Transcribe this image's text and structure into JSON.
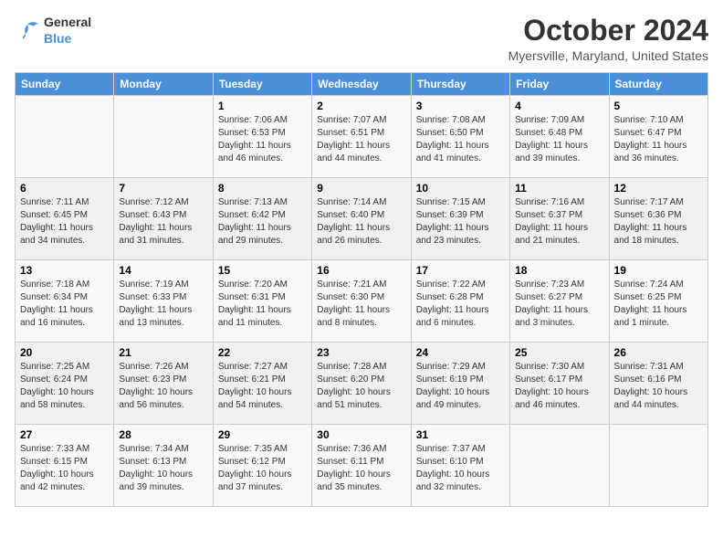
{
  "header": {
    "logo": {
      "general": "General",
      "blue": "Blue"
    },
    "month": "October 2024",
    "location": "Myersville, Maryland, United States"
  },
  "weekdays": [
    "Sunday",
    "Monday",
    "Tuesday",
    "Wednesday",
    "Thursday",
    "Friday",
    "Saturday"
  ],
  "weeks": [
    [
      {
        "day": null
      },
      {
        "day": null
      },
      {
        "day": "1",
        "sunrise": "Sunrise: 7:06 AM",
        "sunset": "Sunset: 6:53 PM",
        "daylight": "Daylight: 11 hours and 46 minutes."
      },
      {
        "day": "2",
        "sunrise": "Sunrise: 7:07 AM",
        "sunset": "Sunset: 6:51 PM",
        "daylight": "Daylight: 11 hours and 44 minutes."
      },
      {
        "day": "3",
        "sunrise": "Sunrise: 7:08 AM",
        "sunset": "Sunset: 6:50 PM",
        "daylight": "Daylight: 11 hours and 41 minutes."
      },
      {
        "day": "4",
        "sunrise": "Sunrise: 7:09 AM",
        "sunset": "Sunset: 6:48 PM",
        "daylight": "Daylight: 11 hours and 39 minutes."
      },
      {
        "day": "5",
        "sunrise": "Sunrise: 7:10 AM",
        "sunset": "Sunset: 6:47 PM",
        "daylight": "Daylight: 11 hours and 36 minutes."
      }
    ],
    [
      {
        "day": "6",
        "sunrise": "Sunrise: 7:11 AM",
        "sunset": "Sunset: 6:45 PM",
        "daylight": "Daylight: 11 hours and 34 minutes."
      },
      {
        "day": "7",
        "sunrise": "Sunrise: 7:12 AM",
        "sunset": "Sunset: 6:43 PM",
        "daylight": "Daylight: 11 hours and 31 minutes."
      },
      {
        "day": "8",
        "sunrise": "Sunrise: 7:13 AM",
        "sunset": "Sunset: 6:42 PM",
        "daylight": "Daylight: 11 hours and 29 minutes."
      },
      {
        "day": "9",
        "sunrise": "Sunrise: 7:14 AM",
        "sunset": "Sunset: 6:40 PM",
        "daylight": "Daylight: 11 hours and 26 minutes."
      },
      {
        "day": "10",
        "sunrise": "Sunrise: 7:15 AM",
        "sunset": "Sunset: 6:39 PM",
        "daylight": "Daylight: 11 hours and 23 minutes."
      },
      {
        "day": "11",
        "sunrise": "Sunrise: 7:16 AM",
        "sunset": "Sunset: 6:37 PM",
        "daylight": "Daylight: 11 hours and 21 minutes."
      },
      {
        "day": "12",
        "sunrise": "Sunrise: 7:17 AM",
        "sunset": "Sunset: 6:36 PM",
        "daylight": "Daylight: 11 hours and 18 minutes."
      }
    ],
    [
      {
        "day": "13",
        "sunrise": "Sunrise: 7:18 AM",
        "sunset": "Sunset: 6:34 PM",
        "daylight": "Daylight: 11 hours and 16 minutes."
      },
      {
        "day": "14",
        "sunrise": "Sunrise: 7:19 AM",
        "sunset": "Sunset: 6:33 PM",
        "daylight": "Daylight: 11 hours and 13 minutes."
      },
      {
        "day": "15",
        "sunrise": "Sunrise: 7:20 AM",
        "sunset": "Sunset: 6:31 PM",
        "daylight": "Daylight: 11 hours and 11 minutes."
      },
      {
        "day": "16",
        "sunrise": "Sunrise: 7:21 AM",
        "sunset": "Sunset: 6:30 PM",
        "daylight": "Daylight: 11 hours and 8 minutes."
      },
      {
        "day": "17",
        "sunrise": "Sunrise: 7:22 AM",
        "sunset": "Sunset: 6:28 PM",
        "daylight": "Daylight: 11 hours and 6 minutes."
      },
      {
        "day": "18",
        "sunrise": "Sunrise: 7:23 AM",
        "sunset": "Sunset: 6:27 PM",
        "daylight": "Daylight: 11 hours and 3 minutes."
      },
      {
        "day": "19",
        "sunrise": "Sunrise: 7:24 AM",
        "sunset": "Sunset: 6:25 PM",
        "daylight": "Daylight: 11 hours and 1 minute."
      }
    ],
    [
      {
        "day": "20",
        "sunrise": "Sunrise: 7:25 AM",
        "sunset": "Sunset: 6:24 PM",
        "daylight": "Daylight: 10 hours and 58 minutes."
      },
      {
        "day": "21",
        "sunrise": "Sunrise: 7:26 AM",
        "sunset": "Sunset: 6:23 PM",
        "daylight": "Daylight: 10 hours and 56 minutes."
      },
      {
        "day": "22",
        "sunrise": "Sunrise: 7:27 AM",
        "sunset": "Sunset: 6:21 PM",
        "daylight": "Daylight: 10 hours and 54 minutes."
      },
      {
        "day": "23",
        "sunrise": "Sunrise: 7:28 AM",
        "sunset": "Sunset: 6:20 PM",
        "daylight": "Daylight: 10 hours and 51 minutes."
      },
      {
        "day": "24",
        "sunrise": "Sunrise: 7:29 AM",
        "sunset": "Sunset: 6:19 PM",
        "daylight": "Daylight: 10 hours and 49 minutes."
      },
      {
        "day": "25",
        "sunrise": "Sunrise: 7:30 AM",
        "sunset": "Sunset: 6:17 PM",
        "daylight": "Daylight: 10 hours and 46 minutes."
      },
      {
        "day": "26",
        "sunrise": "Sunrise: 7:31 AM",
        "sunset": "Sunset: 6:16 PM",
        "daylight": "Daylight: 10 hours and 44 minutes."
      }
    ],
    [
      {
        "day": "27",
        "sunrise": "Sunrise: 7:33 AM",
        "sunset": "Sunset: 6:15 PM",
        "daylight": "Daylight: 10 hours and 42 minutes."
      },
      {
        "day": "28",
        "sunrise": "Sunrise: 7:34 AM",
        "sunset": "Sunset: 6:13 PM",
        "daylight": "Daylight: 10 hours and 39 minutes."
      },
      {
        "day": "29",
        "sunrise": "Sunrise: 7:35 AM",
        "sunset": "Sunset: 6:12 PM",
        "daylight": "Daylight: 10 hours and 37 minutes."
      },
      {
        "day": "30",
        "sunrise": "Sunrise: 7:36 AM",
        "sunset": "Sunset: 6:11 PM",
        "daylight": "Daylight: 10 hours and 35 minutes."
      },
      {
        "day": "31",
        "sunrise": "Sunrise: 7:37 AM",
        "sunset": "Sunset: 6:10 PM",
        "daylight": "Daylight: 10 hours and 32 minutes."
      },
      {
        "day": null
      },
      {
        "day": null
      }
    ]
  ]
}
